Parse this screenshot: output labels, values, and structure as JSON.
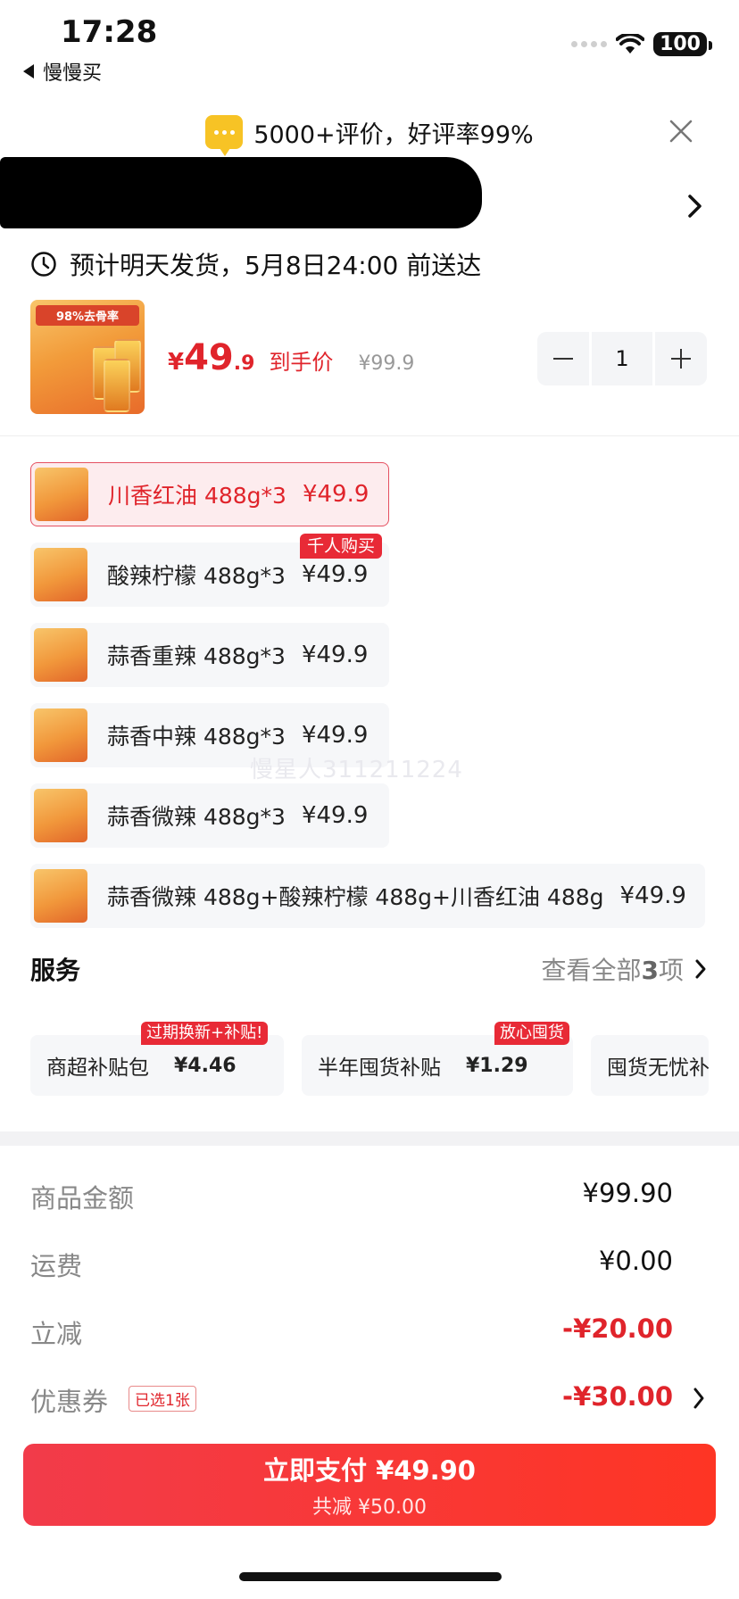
{
  "status_bar": {
    "time": "17:28",
    "back_app": "慢慢买",
    "battery": "100"
  },
  "banner": {
    "text": "5000+评价，好评率99%"
  },
  "delivery": {
    "text": "预计明天发货，5月8日24:00 前送达"
  },
  "product": {
    "thumb_caption": "98%去骨率",
    "price_symbol": "¥",
    "price_int": "49",
    "price_dec": ".9",
    "price_label": "到手价",
    "original_price": "¥99.9",
    "quantity": "1"
  },
  "skus": [
    {
      "name": "川香红油 488g*3",
      "price": "¥49.9"
    },
    {
      "name": "酸辣柠檬 488g*3",
      "price": "¥49.9"
    },
    {
      "name": "蒜香重辣 488g*3",
      "price": "¥49.9"
    },
    {
      "name": "蒜香中辣 488g*3",
      "price": "¥49.9"
    },
    {
      "name": "蒜香微辣 488g*3",
      "price": "¥49.9"
    },
    {
      "name": "蒜香微辣 488g+酸辣柠檬 488g+川香红油 488g",
      "price": "¥49.9"
    }
  ],
  "sku_badge": "千人购买",
  "watermark": "慢星人311211224",
  "services": {
    "title": "服务",
    "view_all_prefix": "查看全部",
    "view_all_count": "3",
    "view_all_suffix": "项",
    "items": [
      {
        "name": "商超补贴包",
        "price": "¥4.46",
        "badge": "过期换新+补贴!"
      },
      {
        "name": "半年囤货补贴",
        "price": "¥1.29",
        "badge": "放心囤货"
      },
      {
        "name": "囤货无忧补",
        "price": ""
      }
    ]
  },
  "totals": {
    "goods_label": "商品金额",
    "goods_value": "¥99.90",
    "shipping_label": "运费",
    "shipping_value": "¥0.00",
    "discount_label": "立减",
    "discount_value": "-¥20.00",
    "coupon_label": "优惠券",
    "coupon_tag": "已选1张",
    "coupon_value": "-¥30.00"
  },
  "pay": {
    "main": "立即支付 ¥49.90",
    "sub": "共减 ¥50.00"
  },
  "colors": {
    "accent": "#e0242b",
    "pay_button": "#f23b4a",
    "badge": "#e82a36"
  }
}
